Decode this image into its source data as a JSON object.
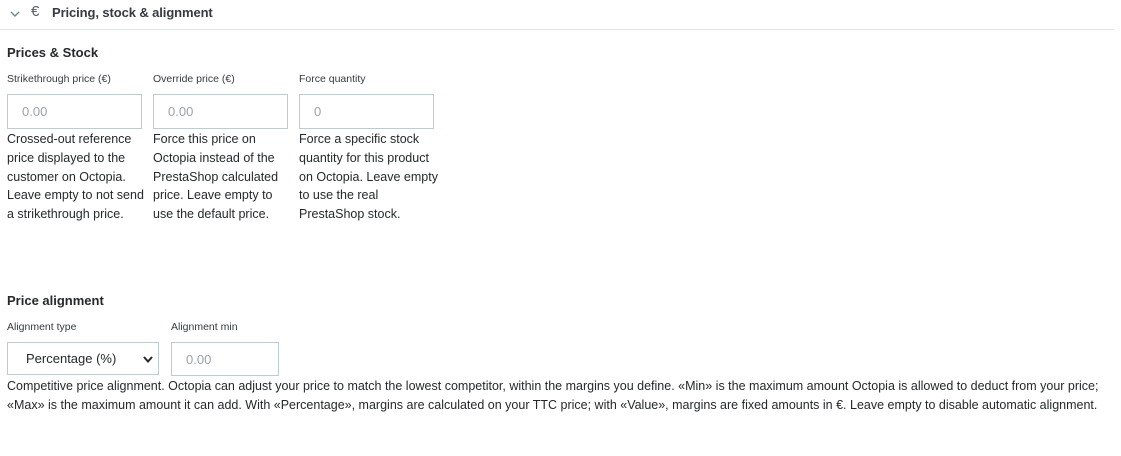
{
  "panel": {
    "title": "Pricing, stock & alignment",
    "collapse_icon": "chevron-down-icon",
    "currency_icon": "euro-icon",
    "currency_glyph": "€"
  },
  "prices_stock": {
    "title": "Prices & Stock",
    "strikethrough": {
      "label": "Strikethrough price (€)",
      "placeholder": "0.00",
      "help": "Crossed-out reference price displayed to the customer on Octopia. Leave empty to not send a strikethrough price."
    },
    "override": {
      "label": "Override price (€)",
      "placeholder": "0.00",
      "help": "Force this price on Octopia instead of the PrestaShop calculated price. Leave empty to use the default price."
    },
    "quantity": {
      "label": "Force quantity",
      "placeholder": "0",
      "help": "Force a specific stock quantity for this product on Octopia. Leave empty to use the real PrestaShop stock."
    }
  },
  "alignment": {
    "title": "Price alignment",
    "type": {
      "label": "Alignment type",
      "selected": "Percentage (%)"
    },
    "min": {
      "label": "Alignment min",
      "placeholder": "0.00"
    },
    "help": "Competitive price alignment. Octopia can adjust your price to match the lowest competitor, within the margins you define. «Min» is the maximum amount Octopia is allowed to deduct from your price; «Max» is the maximum amount it can add. With «Percentage», margins are calculated on your TTC price; with «Value», margins are fixed amounts in €. Leave empty to disable automatic alignment."
  }
}
